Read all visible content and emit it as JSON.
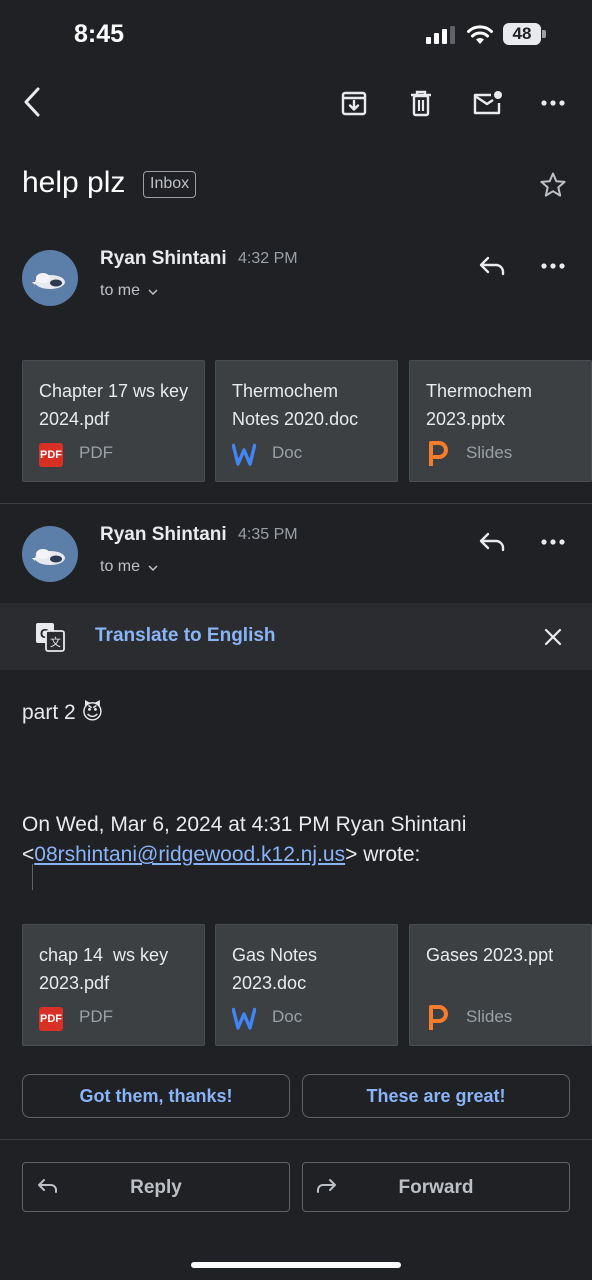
{
  "status_bar": {
    "time": "8:45",
    "battery": "48"
  },
  "toolbar": {
    "icons": [
      "back-icon",
      "archive-icon",
      "delete-icon",
      "mark-unread-icon",
      "more-icon"
    ]
  },
  "subject": {
    "title": "help plz",
    "label": "Inbox"
  },
  "messages": [
    {
      "sender": "Ryan Shintani",
      "time": "4:32 PM",
      "recipient": "to me",
      "attachments": [
        {
          "name": "Chapter 17 ws key 2024.pdf",
          "type": "PDF"
        },
        {
          "name": "Thermochem Notes 2020.doc",
          "type": "Doc"
        },
        {
          "name": "Thermochem 2023.pptx",
          "type": "Slides"
        }
      ]
    },
    {
      "sender": "Ryan Shintani",
      "time": "4:35 PM",
      "recipient": "to me",
      "translate_label": "Translate to English",
      "body": "part 2 😈",
      "quote_prefix": "On Wed, Mar 6, 2024 at 4:31 PM Ryan Shintani",
      "quote_lt": "<",
      "quote_email": "08rshintani@ridgewood.k12.nj.us",
      "quote_suffix": "> wrote:",
      "attachments": [
        {
          "name": "chap 14  ws key 2023.pdf",
          "type": "PDF"
        },
        {
          "name": "Gas Notes 2023.doc",
          "type": "Doc"
        },
        {
          "name": "Gases 2023.ppt",
          "type": "Slides"
        }
      ]
    }
  ],
  "smart_replies": [
    "Got them, thanks!",
    "These are great!"
  ],
  "actions": {
    "reply": "Reply",
    "forward": "Forward"
  },
  "colors": {
    "background": "#202124",
    "link": "#8ab4f8",
    "pdf": "#d93025",
    "doc": "#4285f4",
    "slides": "#f57c2b"
  }
}
